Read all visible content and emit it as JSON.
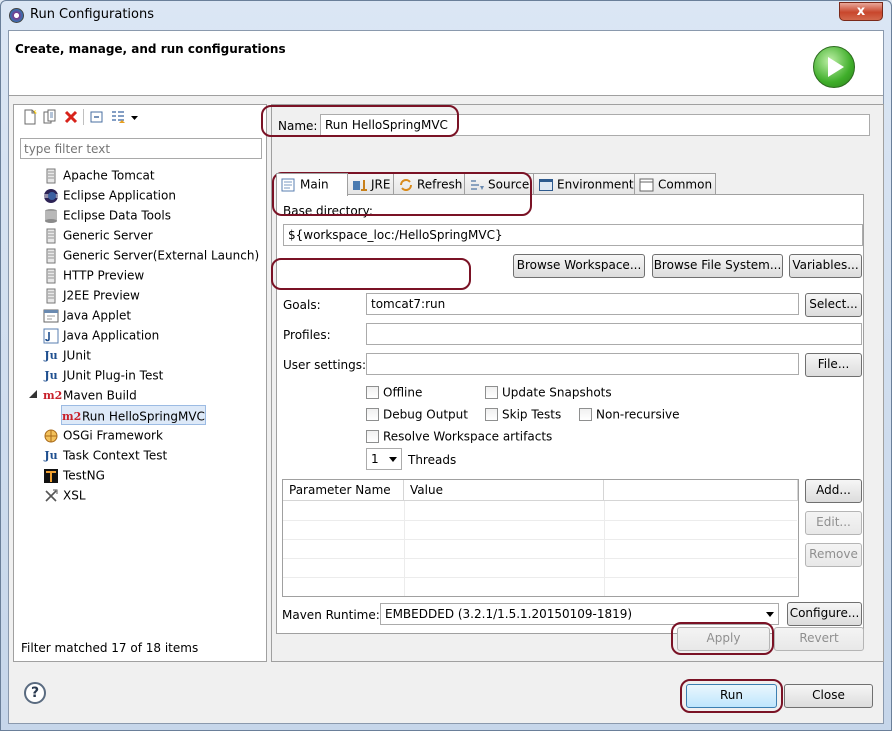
{
  "window": {
    "title": "Run Configurations",
    "close_glyph": "x"
  },
  "banner": {
    "title": "Create, manage, and run configurations"
  },
  "filter": {
    "placeholder": "type filter text",
    "status": "Filter matched 17 of 18 items"
  },
  "tree": [
    {
      "label": "Apache Tomcat",
      "icon": "server-icon"
    },
    {
      "label": "Eclipse Application",
      "icon": "eclipse-icon"
    },
    {
      "label": "Eclipse Data Tools",
      "icon": "database-icon"
    },
    {
      "label": "Generic Server",
      "icon": "server-icon"
    },
    {
      "label": "Generic Server(External Launch)",
      "icon": "server-icon"
    },
    {
      "label": "HTTP Preview",
      "icon": "server-icon"
    },
    {
      "label": "J2EE Preview",
      "icon": "server-icon"
    },
    {
      "label": "Java Applet",
      "icon": "applet-icon"
    },
    {
      "label": "Java Application",
      "icon": "java-app-icon"
    },
    {
      "label": "JUnit",
      "icon": "junit-icon",
      "glyph": "Ju"
    },
    {
      "label": "JUnit Plug-in Test",
      "icon": "junit-plugin-icon",
      "glyph": "Ju"
    },
    {
      "label": "Maven Build",
      "icon": "maven-icon",
      "glyph": "m2",
      "expanded": true
    },
    {
      "label": "Run HelloSpringMVC",
      "icon": "maven-icon",
      "glyph": "m2",
      "child": true,
      "selected": true
    },
    {
      "label": "OSGi Framework",
      "icon": "osgi-icon"
    },
    {
      "label": "Task Context Test",
      "icon": "junit-icon",
      "glyph": "Ju"
    },
    {
      "label": "TestNG",
      "icon": "testng-icon"
    },
    {
      "label": "XSL",
      "icon": "xsl-icon"
    }
  ],
  "config": {
    "name_label": "Name:",
    "name_value": "Run HelloSpringMVC",
    "tabs": [
      {
        "label": "Main",
        "icon": "main-tab-icon",
        "active": true
      },
      {
        "label": "JRE",
        "icon": "jre-icon"
      },
      {
        "label": "Refresh",
        "icon": "refresh-icon"
      },
      {
        "label": "Source",
        "icon": "source-icon"
      },
      {
        "label": "Environment",
        "icon": "environment-icon"
      },
      {
        "label": "Common",
        "icon": "common-icon"
      }
    ],
    "base_dir_label": "Base directory:",
    "base_dir_value": "${workspace_loc:/HelloSpringMVC}",
    "browse_workspace": "Browse Workspace...",
    "browse_fs": "Browse File System...",
    "variables": "Variables...",
    "goals_label": "Goals:",
    "goals_value": "tomcat7:run",
    "select": "Select...",
    "profiles_label": "Profiles:",
    "profiles_value": "",
    "user_settings_label": "User settings:",
    "user_settings_value": "",
    "file": "File...",
    "options": {
      "offline": "Offline",
      "update_snapshots": "Update Snapshots",
      "debug_output": "Debug Output",
      "skip_tests": "Skip Tests",
      "non_recursive": "Non-recursive",
      "resolve_workspace": "Resolve Workspace artifacts"
    },
    "threads_value": "1",
    "threads_label": "Threads",
    "param_headers": [
      "Parameter Name",
      "Value"
    ],
    "add": "Add...",
    "edit": "Edit...",
    "remove": "Remove",
    "runtime_label": "Maven Runtime:",
    "runtime_value": "EMBEDDED (3.2.1/1.5.1.20150109-1819)",
    "configure": "Configure...",
    "apply": "Apply",
    "revert": "Revert"
  },
  "footer": {
    "help": "?",
    "run": "Run",
    "close": "Close"
  },
  "colors": {
    "highlight": "#7a1225",
    "selection": "#dde9f8"
  }
}
